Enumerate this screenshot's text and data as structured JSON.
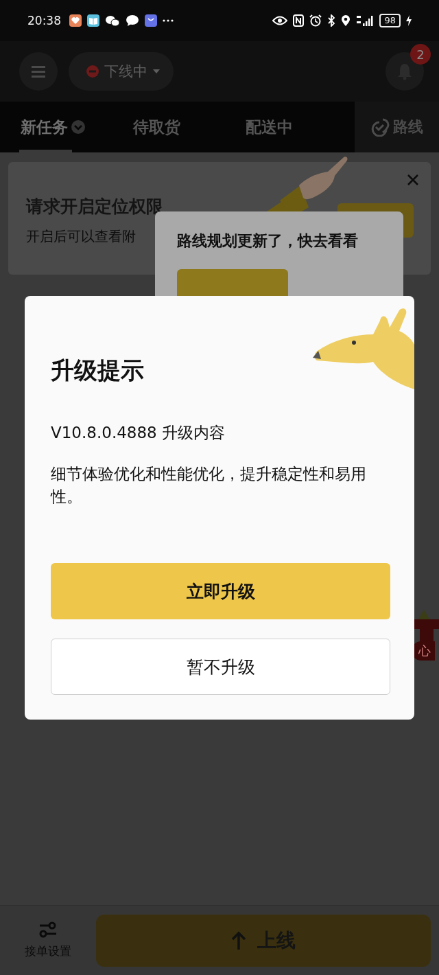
{
  "status_bar": {
    "time": "20:38",
    "battery": "98"
  },
  "header": {
    "status_label": "下线中",
    "notification_count": "2"
  },
  "tabs": [
    {
      "label": "新任务",
      "selected": true,
      "has_dropdown": true
    },
    {
      "label": "待取货",
      "selected": false,
      "has_dropdown": false
    },
    {
      "label": "配送中",
      "selected": false,
      "has_dropdown": false
    }
  ],
  "route_button": {
    "label": "路线"
  },
  "permission_card": {
    "title": "请求开启定位权限",
    "subtitle": "开启后可以查看附"
  },
  "route_tip": {
    "message": "路线规划更新了，快去看看"
  },
  "side_badge": {
    "label": "心"
  },
  "upgrade_dialog": {
    "title": "升级提示",
    "version_line": "V10.8.0.4888 升级内容",
    "description": "细节体验优化和性能优化，提升稳定性和易用性。",
    "buttons": [
      {
        "label": "立即升级",
        "kind": "primary"
      },
      {
        "label": "暂不升级",
        "kind": "secondary"
      }
    ]
  },
  "bottom_bar": {
    "settings_label": "接单设置",
    "go_online_label": "上线"
  }
}
